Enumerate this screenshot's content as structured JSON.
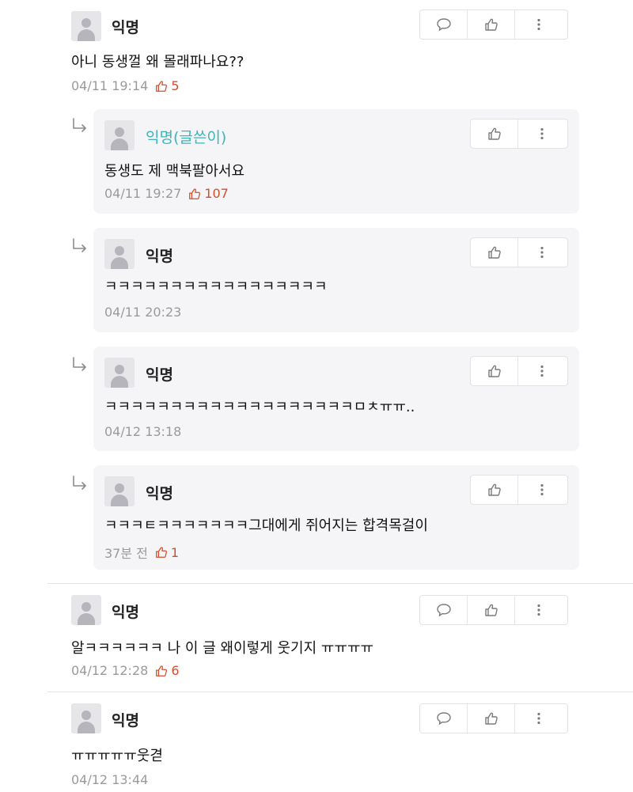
{
  "comments": [
    {
      "name": "익명",
      "text": "아니 동생껄 왜 몰래파나요??",
      "time": "04/11 19:14",
      "likes": "5"
    },
    {
      "name": "익명(글쓴이)",
      "text": "동생도 제 맥북팔아서요",
      "time": "04/11 19:27",
      "likes": "107"
    },
    {
      "name": "익명",
      "text": "ㅋㅋㅋㅋㅋㅋㅋㅋㅋㅋㅋㅋㅋㅋㅋㅋㅋ",
      "time": "04/11 20:23"
    },
    {
      "name": "익명",
      "text": "ㅋㅋㅋㅋㅋㅋㅋㅋㅋㅋㅋㅋㅋㅋㅋㅋㅋㅋㅋㅁㅊㅠㅠ..",
      "time": "04/12 13:18"
    },
    {
      "name": "익명",
      "text": "ㅋㅋㅋㅌㅋㅋㅋㅋㅋㅋㅋ그대에게 쥐어지는 합격목걸이",
      "time": "37분 전",
      "likes": "1"
    },
    {
      "name": "익명",
      "text": "알ㅋㅋㅋㅋㅋㅋ 나 이 글 왜이렇게 웃기지 ㅠㅠㅠㅠ",
      "time": "04/12 12:28",
      "likes": "6"
    },
    {
      "name": "익명",
      "text": "ㅠㅠㅠㅠㅠ웃겯",
      "time": "04/12 13:44"
    }
  ],
  "icons": {
    "comment": "speech-bubble-icon",
    "like": "thumbs-up-icon",
    "more": "vertical-dots-icon",
    "reply": "reply-arrow-icon"
  },
  "colors": {
    "author_name": "#3fb3b6",
    "like_count": "#d24d2e",
    "reply_background": "#f5f5f7"
  }
}
